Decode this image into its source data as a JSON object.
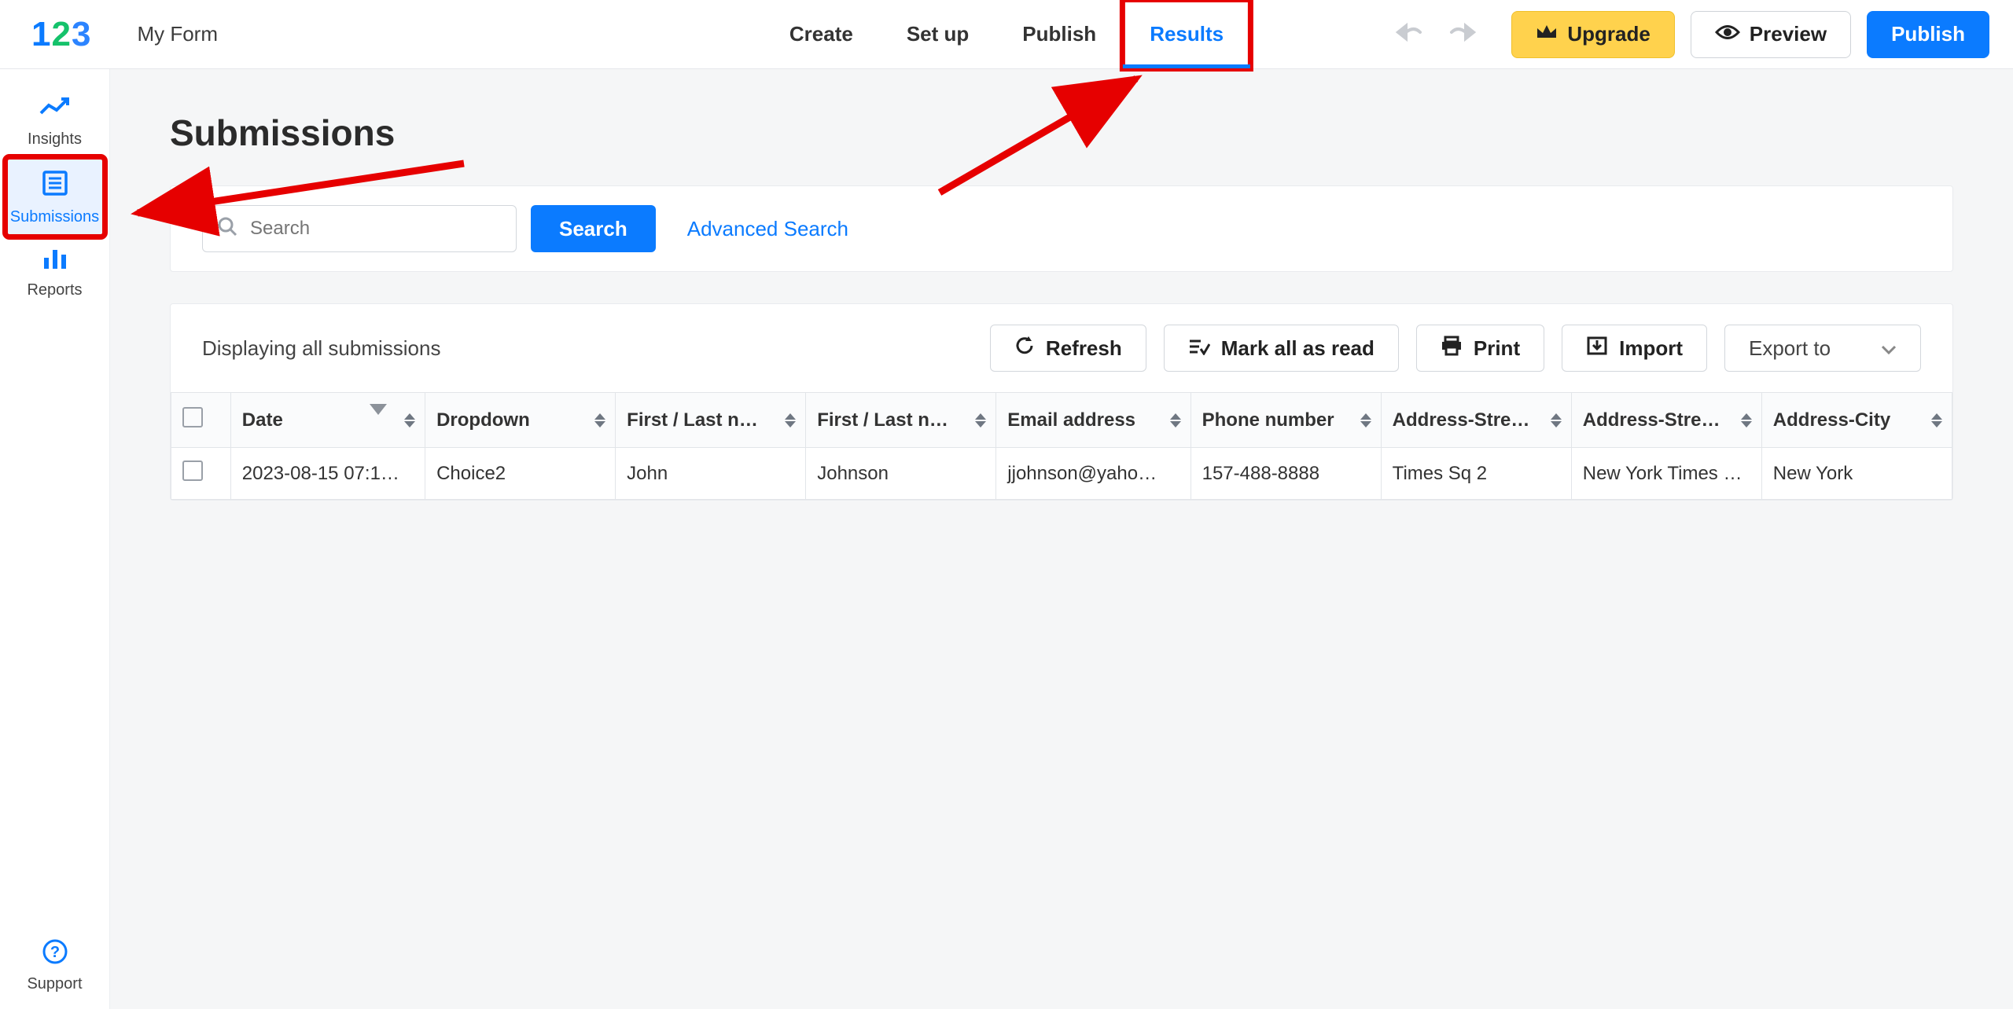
{
  "header": {
    "form_name": "My Form",
    "tabs": [
      "Create",
      "Set up",
      "Publish",
      "Results"
    ],
    "active_tab_index": 3,
    "upgrade_label": "Upgrade",
    "preview_label": "Preview",
    "publish_label": "Publish"
  },
  "sidebar": {
    "items": [
      {
        "label": "Insights"
      },
      {
        "label": "Submissions"
      },
      {
        "label": "Reports"
      }
    ],
    "active_index": 1,
    "support_label": "Support"
  },
  "page": {
    "title": "Submissions",
    "search_placeholder": "Search",
    "search_button": "Search",
    "advanced_search": "Advanced Search",
    "displaying_text": "Displaying all submissions",
    "toolbar": {
      "refresh": "Refresh",
      "mark_read": "Mark all as read",
      "print": "Print",
      "import": "Import",
      "export": "Export to"
    },
    "columns": [
      "Date",
      "Dropdown",
      "First / Last n…",
      "First / Last n…",
      "Email address",
      "Phone number",
      "Address-Stre…",
      "Address-Stre…",
      "Address-City"
    ],
    "rows": [
      {
        "date": "2023-08-15 07:1…",
        "dropdown": "Choice2",
        "first1": "John",
        "first2": "Johnson",
        "email": "jjohnson@yaho…",
        "phone": "157-488-8888",
        "addr1": "Times Sq 2",
        "addr2": "New York Times …",
        "city": "New York"
      }
    ]
  }
}
